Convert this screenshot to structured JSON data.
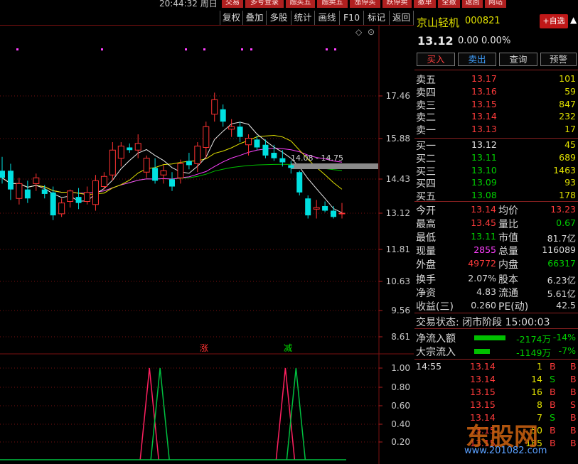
{
  "top_bar": {
    "clock": "20:44:32 周日",
    "buttons": [
      "交易",
      "多号登录",
      "融买五",
      "融卖五",
      "涨停买",
      "跌停卖",
      "撤单",
      "全撤",
      "返回",
      "网站"
    ]
  },
  "toolbar": {
    "buttons": [
      "复权",
      "叠加",
      "多股",
      "统计",
      "画线",
      "F10",
      "标记",
      "返回"
    ]
  },
  "chart": {
    "price_axis_labels": [
      "17.46",
      "15.88",
      "14.43",
      "13.12",
      "11.81",
      "10.63",
      "9.56",
      "8.61"
    ],
    "indicator_axis_labels": [
      "1.00",
      "0.80",
      "0.60",
      "0.40",
      "0.20"
    ],
    "range_annotation": "14.08 - 14.75",
    "markers": {
      "rise": "涨",
      "fall": "减"
    },
    "top_icons": [
      "diamond-icon",
      "settings-circle-icon"
    ],
    "colors": {
      "up": "#ff3232",
      "down": "#00e0e0",
      "ma5": "#e8e8e8",
      "ma10": "#e0e000",
      "ma20": "#ff40ff",
      "ma60": "#00c000",
      "grid": "#7a1010"
    }
  },
  "chart_data": {
    "type": "candlestick",
    "candles": [
      {
        "o": 14.55,
        "h": 15.05,
        "l": 14.1,
        "c": 14.3
      },
      {
        "o": 14.55,
        "h": 14.8,
        "l": 13.55,
        "c": 13.9
      },
      {
        "o": 13.6,
        "h": 14.3,
        "l": 13.4,
        "c": 14.1
      },
      {
        "o": 13.9,
        "h": 14.2,
        "l": 13.45,
        "c": 13.6
      },
      {
        "o": 14.1,
        "h": 14.45,
        "l": 13.85,
        "c": 14.3
      },
      {
        "o": 13.9,
        "h": 14.05,
        "l": 13.6,
        "c": 13.75
      },
      {
        "o": 13.8,
        "h": 14.0,
        "l": 12.9,
        "c": 13.05
      },
      {
        "o": 13.1,
        "h": 13.6,
        "l": 13.0,
        "c": 13.45
      },
      {
        "o": 13.5,
        "h": 13.9,
        "l": 13.3,
        "c": 13.85
      },
      {
        "o": 13.65,
        "h": 13.95,
        "l": 13.25,
        "c": 13.45
      },
      {
        "o": 13.5,
        "h": 14.0,
        "l": 13.4,
        "c": 13.8
      },
      {
        "o": 13.4,
        "h": 14.4,
        "l": 13.2,
        "c": 14.2
      },
      {
        "o": 14.0,
        "h": 14.5,
        "l": 13.9,
        "c": 14.35
      },
      {
        "o": 14.4,
        "h": 15.6,
        "l": 14.2,
        "c": 15.3
      },
      {
        "o": 15.0,
        "h": 15.6,
        "l": 14.7,
        "c": 15.45
      },
      {
        "o": 15.4,
        "h": 15.55,
        "l": 15.2,
        "c": 15.3
      },
      {
        "o": 15.3,
        "h": 15.9,
        "l": 15.0,
        "c": 15.55
      },
      {
        "o": 14.5,
        "h": 15.1,
        "l": 14.3,
        "c": 15.0
      },
      {
        "o": 14.65,
        "h": 15.0,
        "l": 14.1,
        "c": 14.2
      },
      {
        "o": 14.4,
        "h": 14.75,
        "l": 14.1,
        "c": 14.55
      },
      {
        "o": 14.25,
        "h": 14.5,
        "l": 13.85,
        "c": 14.0
      },
      {
        "o": 14.3,
        "h": 14.95,
        "l": 14.1,
        "c": 14.8
      },
      {
        "o": 14.9,
        "h": 15.2,
        "l": 14.6,
        "c": 14.75
      },
      {
        "o": 14.8,
        "h": 15.6,
        "l": 14.5,
        "c": 15.45
      },
      {
        "o": 15.4,
        "h": 16.4,
        "l": 15.0,
        "c": 16.2
      },
      {
        "o": 16.7,
        "h": 17.6,
        "l": 16.4,
        "c": 17.3
      },
      {
        "o": 16.9,
        "h": 17.1,
        "l": 16.2,
        "c": 16.4
      },
      {
        "o": 16.1,
        "h": 16.5,
        "l": 15.8,
        "c": 16.2
      },
      {
        "o": 16.2,
        "h": 16.4,
        "l": 15.6,
        "c": 15.8
      },
      {
        "o": 15.5,
        "h": 15.9,
        "l": 15.1,
        "c": 15.75
      },
      {
        "o": 15.7,
        "h": 15.85,
        "l": 15.3,
        "c": 15.4
      },
      {
        "o": 15.5,
        "h": 15.7,
        "l": 15.0,
        "c": 15.1
      },
      {
        "o": 15.2,
        "h": 15.5,
        "l": 14.9,
        "c": 15.0
      },
      {
        "o": 15.0,
        "h": 15.3,
        "l": 14.7,
        "c": 14.85
      },
      {
        "o": 14.75,
        "h": 14.9,
        "l": 14.45,
        "c": 14.65
      },
      {
        "o": 14.5,
        "h": 14.55,
        "l": 13.7,
        "c": 13.8
      },
      {
        "o": 13.6,
        "h": 13.7,
        "l": 12.95,
        "c": 13.05
      },
      {
        "o": 13.25,
        "h": 13.55,
        "l": 12.95,
        "c": 13.3
      },
      {
        "o": 13.35,
        "h": 13.5,
        "l": 13.15,
        "c": 13.2
      },
      {
        "o": 13.2,
        "h": 13.35,
        "l": 12.95,
        "c": 13.0
      },
      {
        "o": 13.12,
        "h": 13.45,
        "l": 12.95,
        "c": 13.12
      }
    ],
    "indicator": {
      "red_series": [
        0,
        0,
        0,
        0,
        0,
        0,
        0,
        0,
        0,
        0,
        0,
        0,
        0,
        0,
        0,
        0,
        1,
        0,
        0,
        0,
        0,
        0,
        0,
        0,
        0,
        0,
        0,
        0,
        0,
        0,
        0,
        0,
        1,
        0,
        0,
        0,
        0,
        0,
        0,
        0,
        0
      ],
      "green_series": [
        0,
        0,
        0,
        0,
        0,
        0,
        0,
        0,
        0,
        0,
        0,
        0,
        0,
        0,
        0,
        0,
        0,
        1,
        0,
        0,
        0,
        0,
        0,
        0,
        0,
        0,
        0,
        0,
        0,
        0,
        0,
        0,
        0,
        1,
        0,
        0,
        0,
        0,
        0,
        0,
        0
      ]
    }
  },
  "panel": {
    "name": "京山轻机",
    "code": "000821",
    "fav_label": "+自选",
    "price": "13.12",
    "change": "0.00",
    "change_pct": "0.00%",
    "actions": [
      "买入",
      "卖出",
      "查询",
      "预警"
    ],
    "asks": [
      {
        "label": "卖五",
        "price": "13.17",
        "vol": "101"
      },
      {
        "label": "卖四",
        "price": "13.16",
        "vol": "59"
      },
      {
        "label": "卖三",
        "price": "13.15",
        "vol": "847"
      },
      {
        "label": "卖二",
        "price": "13.14",
        "vol": "232"
      },
      {
        "label": "卖一",
        "price": "13.13",
        "vol": "17"
      }
    ],
    "bids": [
      {
        "label": "买一",
        "price": "13.12",
        "vol": "45"
      },
      {
        "label": "买二",
        "price": "13.11",
        "vol": "689"
      },
      {
        "label": "买三",
        "price": "13.10",
        "vol": "1463"
      },
      {
        "label": "买四",
        "price": "13.09",
        "vol": "93"
      },
      {
        "label": "买五",
        "price": "13.08",
        "vol": "178"
      }
    ],
    "stats": [
      {
        "l1": "今开",
        "v1": "13.14",
        "c1": "#ff3b3b",
        "l2": "均价",
        "v2": "13.23",
        "c2": "#ff3b3b"
      },
      {
        "l1": "最高",
        "v1": "13.45",
        "c1": "#ff3b3b",
        "l2": "量比",
        "v2": "0.67",
        "c2": "#00d000"
      },
      {
        "l1": "最低",
        "v1": "13.11",
        "c1": "#00d000",
        "l2": "市值",
        "v2": "81.7亿",
        "c2": "#d8d8d8"
      },
      {
        "l1": "现量",
        "v1": "2855",
        "c1": "#ff40ff",
        "l2": "总量",
        "v2": "116089",
        "c2": "#d8d8d8"
      },
      {
        "l1": "外盘",
        "v1": "49772",
        "c1": "#ff3b3b",
        "l2": "内盘",
        "v2": "66317",
        "c2": "#00d000"
      },
      {
        "l1": "换手",
        "v1": "2.07%",
        "c1": "#d8d8d8",
        "l2": "股本",
        "v2": "6.23亿",
        "c2": "#d8d8d8"
      },
      {
        "l1": "净资",
        "v1": "4.83",
        "c1": "#d8d8d8",
        "l2": "流通",
        "v2": "5.61亿",
        "c2": "#d8d8d8"
      },
      {
        "l1": "收益(三)",
        "v1": "0.260",
        "c1": "#d8d8d8",
        "l2": "PE(动)",
        "v2": "42.5",
        "c2": "#d8d8d8"
      }
    ],
    "trade_state": "交易状态: 闭市阶段 15:00:03",
    "flows": [
      {
        "label": "净流入额",
        "value": "-2174万",
        "pct": "-14%"
      },
      {
        "label": "大宗流入",
        "value": "-1149万",
        "pct": "-7%"
      }
    ],
    "ticks": [
      {
        "time": "14:55",
        "price": "13.14",
        "vol": "1",
        "dir": "B",
        "dir_color": "#ff3b3b",
        "ext": "B"
      },
      {
        "time": "",
        "price": "13.14",
        "vol": "14",
        "dir": "S",
        "dir_color": "#00d000",
        "ext": "B"
      },
      {
        "time": "",
        "price": "13.15",
        "vol": "16",
        "dir": "B",
        "dir_color": "#ff3b3b",
        "ext": "B"
      },
      {
        "time": "",
        "price": "13.15",
        "vol": "8",
        "dir": "B",
        "dir_color": "#ff3b3b",
        "ext": "S"
      },
      {
        "time": "",
        "price": "13.14",
        "vol": "7",
        "dir": "S",
        "dir_color": "#00d000",
        "ext": "B"
      },
      {
        "time": "",
        "price": "13.15",
        "vol": "50",
        "dir": "B",
        "dir_color": "#ff3b3b",
        "ext": "B"
      },
      {
        "time": "",
        "price": "13.15",
        "vol": "185",
        "dir": "B",
        "dir_color": "#ff3b3b",
        "ext": "B"
      }
    ],
    "watermark": {
      "logo": "东股网",
      "url": "www.201082.com"
    }
  }
}
